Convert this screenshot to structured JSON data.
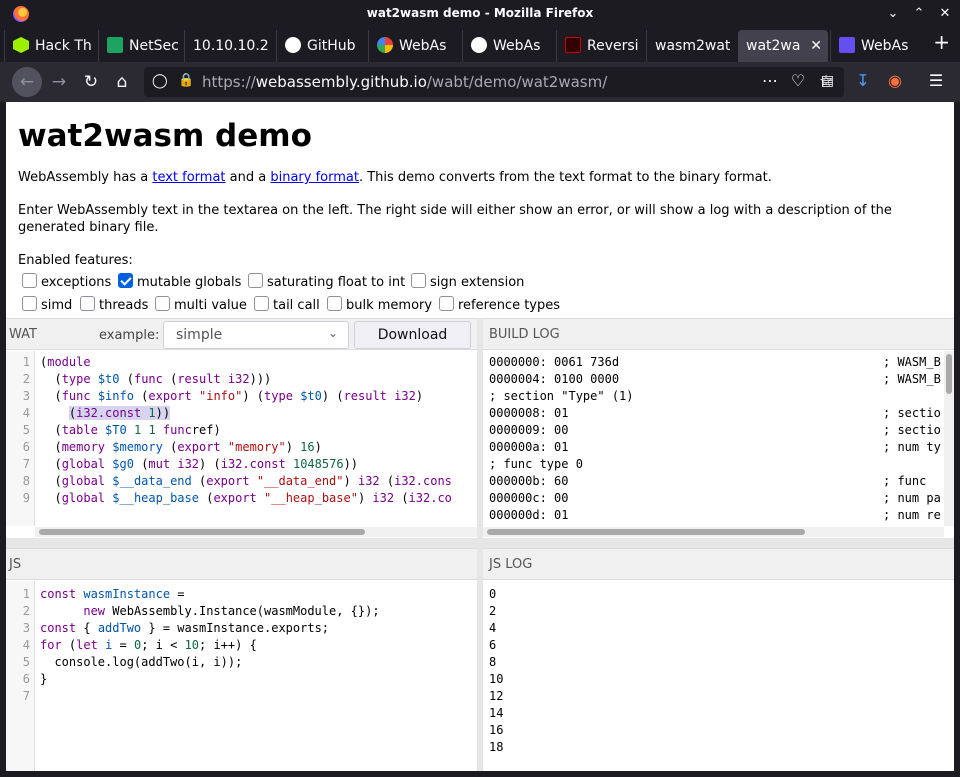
{
  "window": {
    "title": "wat2wasm demo - Mozilla Firefox"
  },
  "tabs": [
    {
      "label": "Hack Th",
      "icon": "hackthebox-icon",
      "color": "#9fef00"
    },
    {
      "label": "NetSec",
      "icon": "netsec-icon",
      "color": "#1da462"
    },
    {
      "label": "10.10.10.2",
      "icon": "",
      "color": ""
    },
    {
      "label": "GitHub",
      "icon": "github-icon",
      "color": "#ffffff"
    },
    {
      "label": "WebAs",
      "icon": "google-icon",
      "color": "#4285f4"
    },
    {
      "label": "WebAs",
      "icon": "ghost-icon",
      "color": "#ffffff"
    },
    {
      "label": "Reversi",
      "icon": "reversing-icon",
      "color": "#cc0000"
    },
    {
      "label": "wasm2wat",
      "icon": "",
      "color": ""
    },
    {
      "label": "wat2wa",
      "icon": "",
      "color": ""
    },
    {
      "label": "WebAs",
      "icon": "webassembly-icon",
      "color": "#654ff0"
    }
  ],
  "urlbar": {
    "prefix": "https://",
    "host": "webassembly.github.io",
    "path": "/wabt/demo/wat2wasm/"
  },
  "page": {
    "title": "wat2wasm demo",
    "intro": {
      "t1": "WebAssembly has a ",
      "link1": "text format",
      "t2": " and a ",
      "link2": "binary format",
      "t3": ". This demo converts from the text format to the binary format."
    },
    "instructions_line1": "Enter WebAssembly text in the textarea on the left. The right side will either show an error, or will show a log with a description of the",
    "instructions_line2": "generated binary file.",
    "features_label": "Enabled features:",
    "features": [
      {
        "label": "exceptions",
        "checked": false
      },
      {
        "label": "mutable globals",
        "checked": true
      },
      {
        "label": "saturating float to int",
        "checked": false
      },
      {
        "label": "sign extension",
        "checked": false
      },
      {
        "label": "simd",
        "checked": false
      },
      {
        "label": "threads",
        "checked": false
      },
      {
        "label": "multi value",
        "checked": false
      },
      {
        "label": "tail call",
        "checked": false
      },
      {
        "label": "bulk memory",
        "checked": false
      },
      {
        "label": "reference types",
        "checked": false
      }
    ]
  },
  "wat_panel": {
    "title": "WAT",
    "example_label": "example:",
    "example_value": "simple",
    "download_label": "Download"
  },
  "build_log_panel": {
    "title": "BUILD LOG"
  },
  "js_panel": {
    "title": "JS"
  },
  "js_log_panel": {
    "title": "JS LOG"
  },
  "build_log": [
    {
      "left": "0000000: 0061 736d",
      "right": "; WASM_B"
    },
    {
      "left": "0000004: 0100 0000",
      "right": "; WASM_B"
    },
    {
      "left": "; section \"Type\" (1)",
      "right": ""
    },
    {
      "left": "0000008: 01",
      "right": "; sectio"
    },
    {
      "left": "0000009: 00",
      "right": "; sectio"
    },
    {
      "left": "000000a: 01",
      "right": "; num ty"
    },
    {
      "left": "; func type 0",
      "right": ""
    },
    {
      "left": "000000b: 60",
      "right": "; func"
    },
    {
      "left": "000000c: 00",
      "right": "; num pa"
    },
    {
      "left": "000000d: 01",
      "right": "; num re"
    }
  ],
  "js_log": [
    "0",
    "2",
    "4",
    "6",
    "8",
    "10",
    "12",
    "14",
    "16",
    "18"
  ]
}
